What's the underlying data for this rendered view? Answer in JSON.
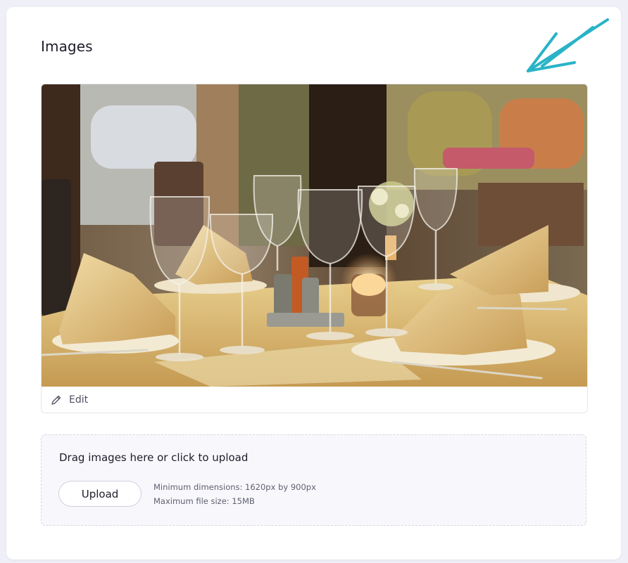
{
  "section": {
    "title": "Images"
  },
  "image_card": {
    "alt": "Restaurant table with wine glasses, folded napkins and a candle",
    "edit_label": "Edit"
  },
  "upload": {
    "prompt": "Drag images here or click to upload",
    "button_label": "Upload",
    "min_dimensions": "Minimum dimensions: 1620px by 900px",
    "max_size": "Maximum file size: 15MB"
  },
  "colors": {
    "annotation_arrow": "#29b3c7",
    "background": "#eeeff7",
    "card": "#ffffff",
    "dropzone": "#f8f8fc"
  },
  "icons": [
    "pencil-icon",
    "annotation-arrow-icon"
  ]
}
